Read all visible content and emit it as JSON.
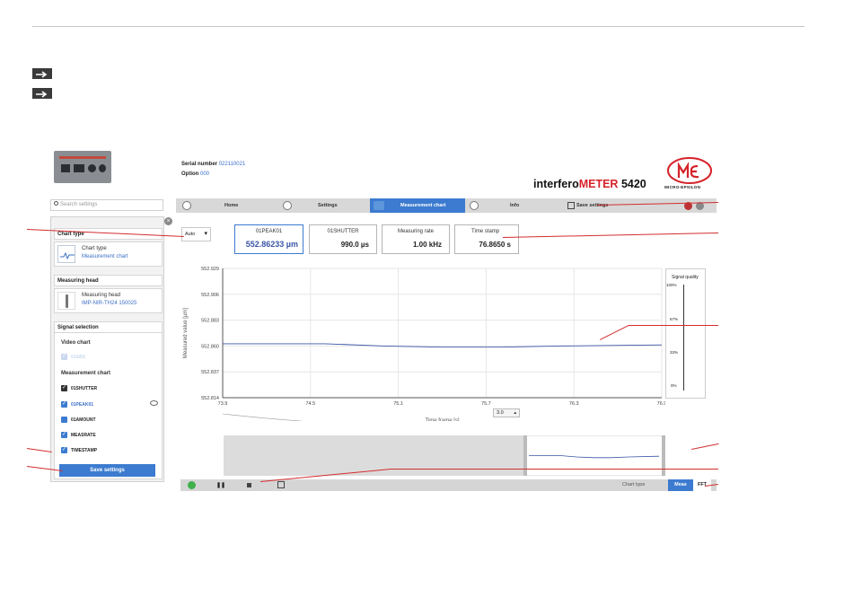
{
  "header": {
    "serial_label": "Serial number",
    "serial_value": "022110021",
    "option_label": "Option",
    "option_value": "000",
    "brand_prefix": "interfero",
    "brand_mid": "METER",
    "brand_model": "5420",
    "logo_text": "MICRO-EPSILON"
  },
  "search": {
    "placeholder": "Search settings"
  },
  "nav": {
    "home": "Home",
    "settings": "Settings",
    "measurement_chart": "Measurement chart",
    "info": "Info",
    "save_settings": "Save settings"
  },
  "sidebar": {
    "chart_type_header": "Chart type",
    "chart_type_title": "Chart type",
    "chart_type_value": "Measurement chart",
    "measuring_head_header": "Measuring head",
    "measuring_head_title": "Measuring head",
    "measuring_head_value": "IMP-NIR-TH24 150025",
    "signal_selection_header": "Signal selection",
    "video_chart_label": "Video chart",
    "video_item": "01ABS",
    "measurement_chart_label": "Measurement chart",
    "signals": [
      "01SHUTTER",
      "01PEAK01",
      "01AMOUNT",
      "MEASRATE",
      "TIMESTAMP"
    ],
    "save_button": "Save settings"
  },
  "controls": {
    "auto_select": "Auto"
  },
  "measure_boxes": [
    {
      "label": "01PEAK01",
      "value": "552.86233 µm"
    },
    {
      "label": "01SHUTTER",
      "value": "990.0  µs"
    },
    {
      "label": "Measuring rate",
      "value": "1.00  kHz"
    },
    {
      "label": "Time stamp",
      "value": "76.8650  s"
    }
  ],
  "chart_data": {
    "type": "line",
    "ylabel": "Measured value [µm]",
    "xlabel": "Time frame [s]",
    "yticks": [
      "552.929",
      "552.906",
      "552.883",
      "552.860",
      "552.837",
      "552.814"
    ],
    "xticks": [
      "73.9",
      "74.5",
      "75.1",
      "75.7",
      "76.3",
      "76.9"
    ],
    "ylim": [
      552.814,
      552.929
    ],
    "xlim": [
      73.9,
      76.9
    ],
    "time_frame_value": "3.0",
    "series": [
      {
        "x": [
          73.9,
          74.6,
          75.0,
          75.4,
          75.8,
          76.2,
          76.9
        ],
        "values": [
          552.862,
          552.862,
          552.86,
          552.859,
          552.859,
          552.86,
          552.861
        ]
      }
    ]
  },
  "signal_quality": {
    "title": "Signal quality",
    "ticks": [
      "100%",
      "67%",
      "33%",
      "0%"
    ],
    "level": 0
  },
  "toolbar": {
    "chart_type_label": "Chart type",
    "meas_button": "Meas",
    "fft_button": "FFT"
  },
  "colors": {
    "accent": "#3c7bd0",
    "brand_red": "#d6222a",
    "annotation": "#d32d2d",
    "series": "#3b55a6"
  }
}
